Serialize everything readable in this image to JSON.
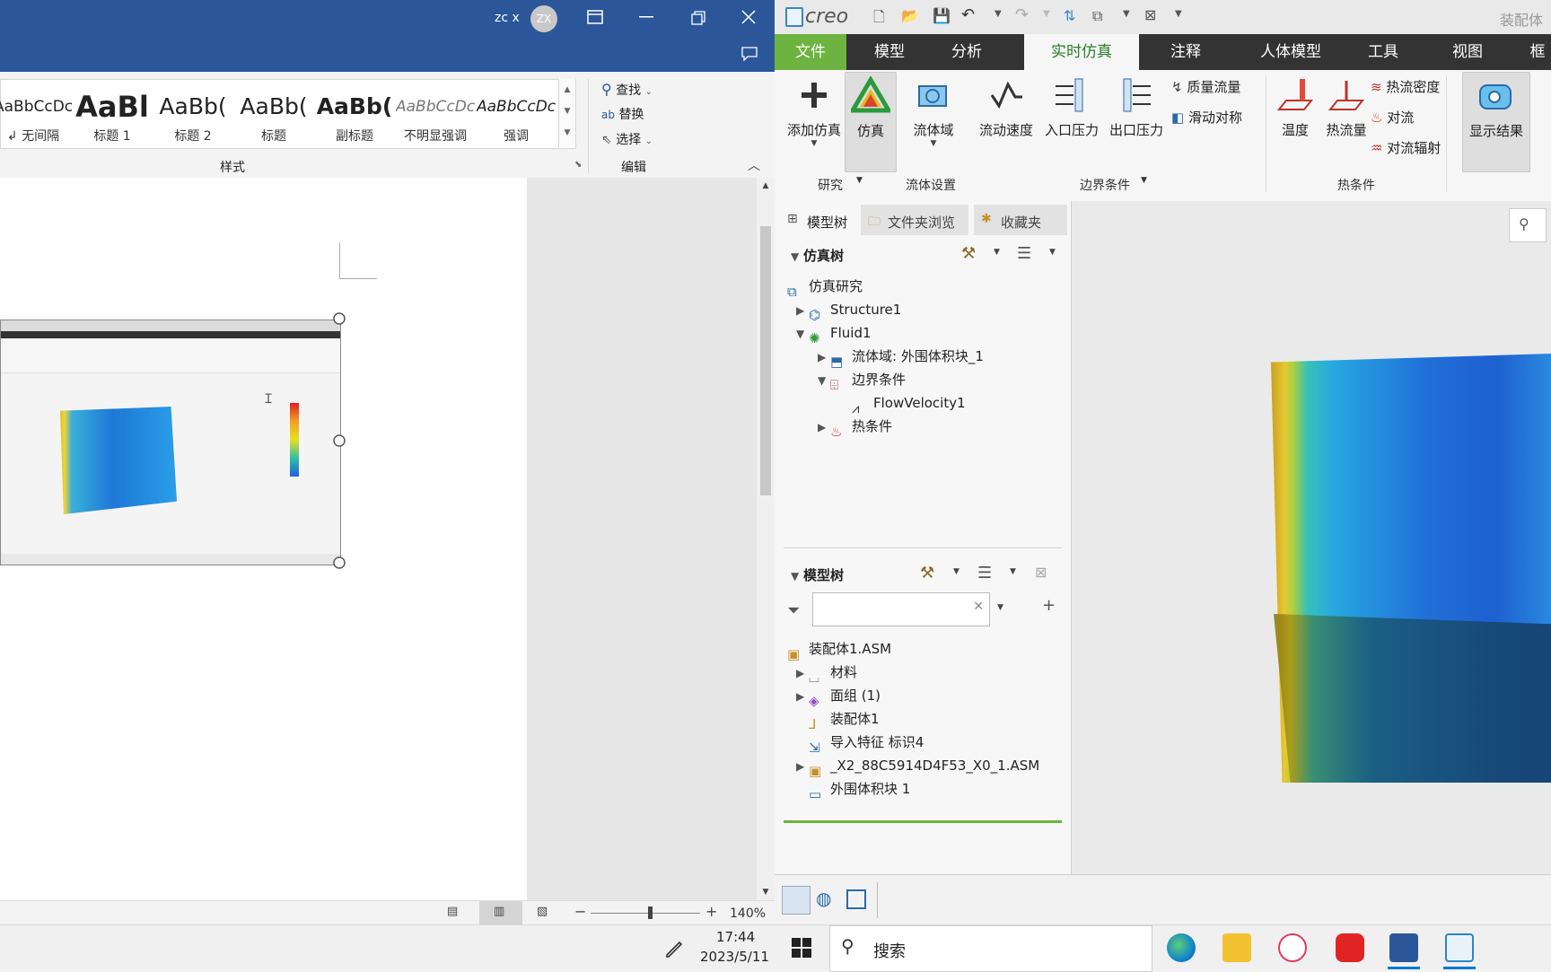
{
  "word": {
    "user_name": "zc x",
    "avatar_initials": "ZX",
    "styles": [
      {
        "sample": "AaBbCcDc",
        "name": "↲ 无间隔"
      },
      {
        "sample": "AaBl",
        "name": "标题 1"
      },
      {
        "sample": "AaBb(",
        "name": "标题 2"
      },
      {
        "sample": "AaBb(",
        "name": "标题"
      },
      {
        "sample": "AaBb(",
        "name": "副标题"
      },
      {
        "sample": "AaBbCcDc",
        "name": "不明显强调"
      },
      {
        "sample": "AaBbCcDc",
        "name": "强调"
      }
    ],
    "styles_group_label": "样式",
    "edit": {
      "find": "查找",
      "replace": "替换",
      "select": "选择",
      "group_label": "编辑"
    },
    "zoom": "140%"
  },
  "creo": {
    "logo": "creo",
    "window_title": "装配体",
    "menu": [
      "文件",
      "模型",
      "分析",
      "实时仿真",
      "注释",
      "人体模型",
      "工具",
      "视图",
      "框"
    ],
    "active_menu": "实时仿真",
    "ribbon": {
      "add_study": "添加仿真",
      "simulate": "仿真",
      "fluid_domain": "流体域",
      "flow_velocity": "流动速度",
      "inlet_pressure": "入口压力",
      "outlet_pressure": "出口压力",
      "mass_flow": "质量流量",
      "slip_symmetry": "滑动对称",
      "temperature": "温度",
      "heat_flow": "热流量",
      "heat_flux": "热流密度",
      "convection": "对流",
      "convection_radiation": "对流辐射",
      "show_results": "显示结果",
      "groups": {
        "study": "研究",
        "fluid_setup": "流体设置",
        "boundary": "边界条件",
        "thermal": "热条件"
      }
    },
    "panel_tabs": [
      "模型树",
      "文件夹浏览",
      "收藏夹"
    ],
    "sim_tree": {
      "title": "仿真树",
      "items": [
        {
          "label": "仿真研究"
        },
        {
          "label": "Structure1"
        },
        {
          "label": "Fluid1"
        },
        {
          "label": "流体域: 外围体积块_1"
        },
        {
          "label": "边界条件"
        },
        {
          "label": "FlowVelocity1"
        },
        {
          "label": "热条件"
        }
      ]
    },
    "model_tree": {
      "title": "模型树",
      "items": [
        {
          "label": "装配体1.ASM"
        },
        {
          "label": "材料"
        },
        {
          "label": "面组 (1)"
        },
        {
          "label": "装配体1"
        },
        {
          "label": "导入特征 标识4"
        },
        {
          "label": "_X2_88C5914D4F53_X0_1.ASM"
        },
        {
          "label": "外围体积块 1"
        }
      ]
    }
  },
  "taskbar": {
    "time": "17:44",
    "date": "2023/5/11",
    "search_placeholder": "搜索"
  },
  "colors": {
    "word_blue": "#2b579a",
    "creo_green": "#6db33f",
    "creo_menubar": "#333333"
  }
}
